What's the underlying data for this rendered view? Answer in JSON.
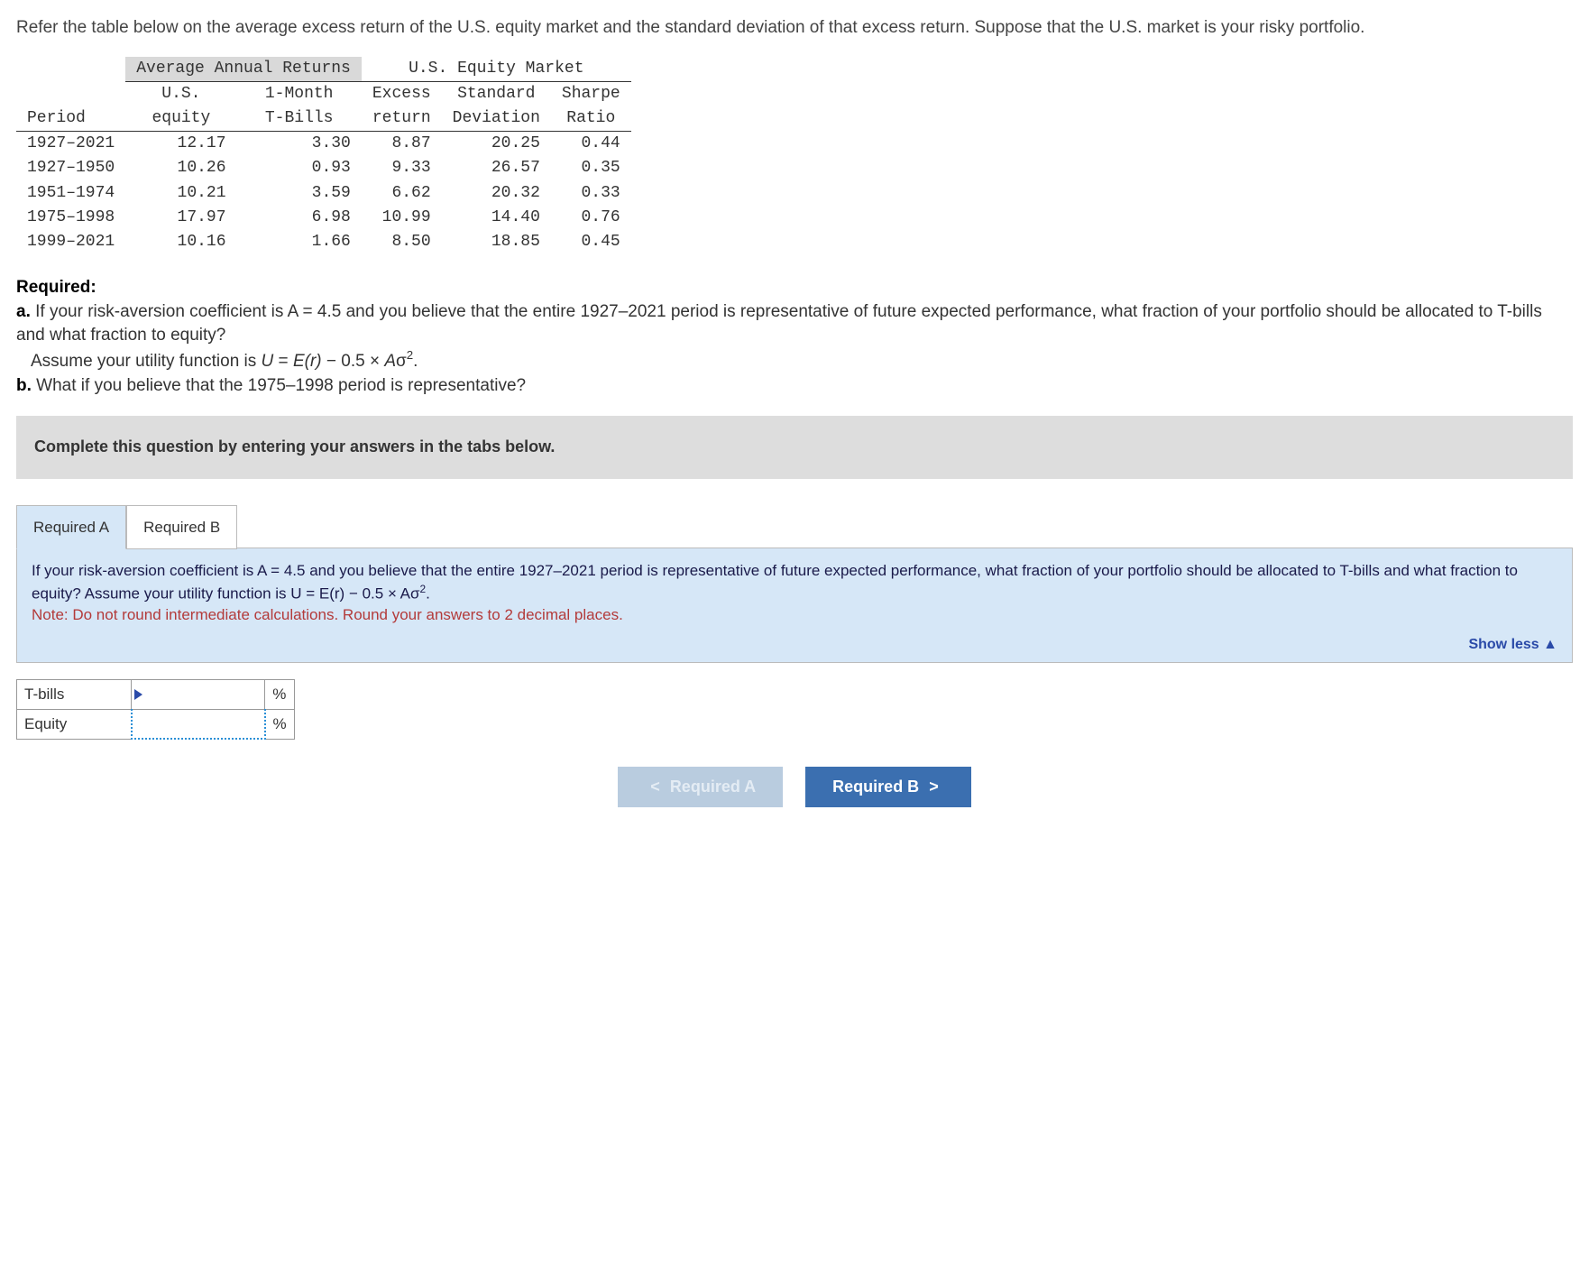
{
  "intro": "Refer the table below on the average excess return of the U.S. equity market and the standard deviation of that excess return. Suppose that the U.S. market is your risky portfolio.",
  "table": {
    "group1": "Average Annual Returns",
    "group2": "U.S. Equity Market",
    "headers": {
      "period": "Period",
      "us_equity_1": "U.S.",
      "us_equity_2": "equity",
      "tbills_1": "1-Month",
      "tbills_2": "T-Bills",
      "excess_1": "Excess",
      "excess_2": "return",
      "std_1": "Standard",
      "std_2": "Deviation",
      "sharpe_1": "Sharpe",
      "sharpe_2": "Ratio"
    },
    "rows": [
      {
        "period": "1927–2021",
        "equity": "12.17",
        "tbills": "3.30",
        "excess": "8.87",
        "std": "20.25",
        "sharpe": "0.44"
      },
      {
        "period": "1927–1950",
        "equity": "10.26",
        "tbills": "0.93",
        "excess": "9.33",
        "std": "26.57",
        "sharpe": "0.35"
      },
      {
        "period": "1951–1974",
        "equity": "10.21",
        "tbills": "3.59",
        "excess": "6.62",
        "std": "20.32",
        "sharpe": "0.33"
      },
      {
        "period": "1975–1998",
        "equity": "17.97",
        "tbills": "6.98",
        "excess": "10.99",
        "std": "14.40",
        "sharpe": "0.76"
      },
      {
        "period": "1999–2021",
        "equity": "10.16",
        "tbills": "1.66",
        "excess": "8.50",
        "std": "18.85",
        "sharpe": "0.45"
      }
    ]
  },
  "required": {
    "heading": "Required:",
    "a_prefix": "a.",
    "a_text": "If your risk-aversion coefficient is A = 4.5 and you believe that the entire 1927–2021 period is representative of future expected performance, what fraction of your portfolio should be allocated to T-bills and what fraction to equity?",
    "a_assume_1": "Assume your utility function is ",
    "a_assume_formula_u": "U",
    "a_assume_formula_eq": " = ",
    "a_assume_formula_er": "E(r)",
    "a_assume_formula_minus": " − 0.5 × ",
    "a_assume_formula_a": "A",
    "a_assume_formula_sigma": "σ",
    "a_assume_formula_sup": "2",
    "a_assume_period": ".",
    "b_prefix": "b.",
    "b_text": "What if you believe that the 1975–1998 period is representative?"
  },
  "instruction": "Complete this question by entering your answers in the tabs below.",
  "tabs": {
    "a": "Required A",
    "b": "Required B"
  },
  "panel": {
    "line1": "If your risk-aversion coefficient is A = 4.5 and you believe that the entire 1927–2021 period is representative of future expected performance, what fraction of your portfolio should be allocated to T-bills and what fraction to equity? Assume your utility function is U = E(r) − 0.5 × Aσ",
    "sup": "2",
    "period": ".",
    "note": "Note: Do not round intermediate calculations. Round your answers to 2 decimal places.",
    "show_less": "Show less",
    "tri": "▲"
  },
  "answers": {
    "tbills_label": "T-bills",
    "equity_label": "Equity",
    "pct": "%"
  },
  "nav": {
    "prev_chev": "<",
    "prev": "Required A",
    "next": "Required B",
    "next_chev": ">"
  }
}
